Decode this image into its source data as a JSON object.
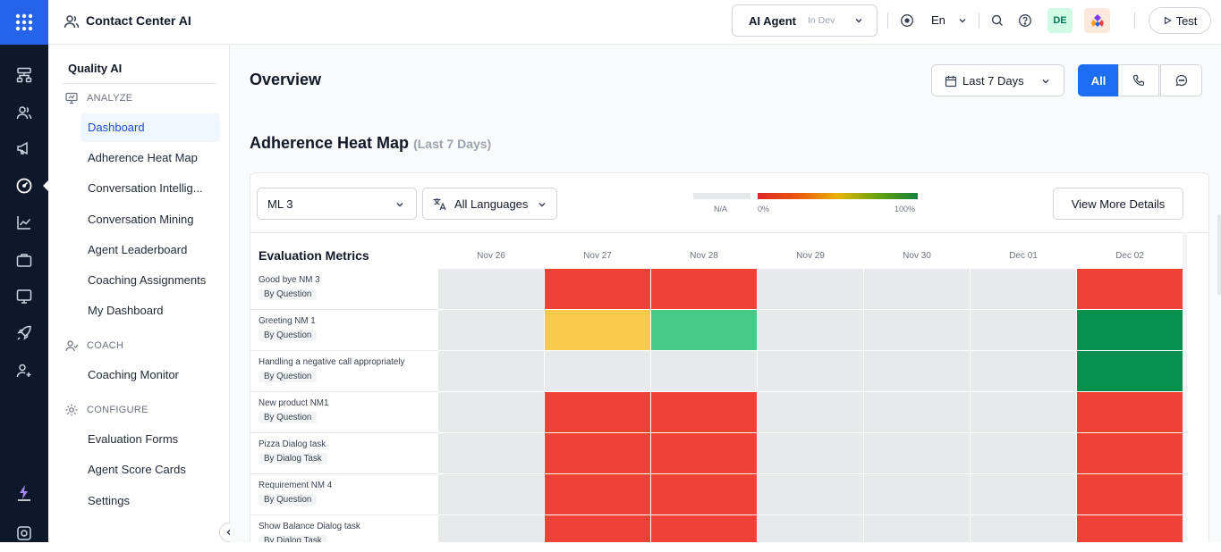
{
  "app": {
    "title": "Contact Center AI"
  },
  "topbar": {
    "agent_label": "AI Agent",
    "agent_env": "In Dev",
    "language": "En",
    "avatar_initials": "DE",
    "test_label": "Test"
  },
  "sidebar": {
    "header": "Quality AI",
    "sections": {
      "analyze": "ANALYZE",
      "coach": "COACH",
      "configure": "CONFIGURE"
    },
    "analyze_items": [
      "Dashboard",
      "Adherence Heat Map",
      "Conversation Intellig...",
      "Conversation Mining",
      "Agent Leaderboard",
      "Coaching Assignments",
      "My Dashboard"
    ],
    "coach_items": [
      "Coaching Monitor"
    ],
    "configure_items": [
      "Evaluation Forms",
      "Agent Score Cards",
      "Settings"
    ],
    "active_item": "Dashboard"
  },
  "overview": {
    "title": "Overview",
    "date_range": "Last 7 Days",
    "channel_all": "All"
  },
  "heatmap": {
    "title": "Adherence Heat Map",
    "subtitle": "(Last 7 Days)",
    "model_select": "ML 3",
    "language_select": "All Languages",
    "legend_na": "N/A",
    "legend_min": "0%",
    "legend_max": "100%",
    "view_more": "View More Details",
    "metrics_header": "Evaluation Metrics",
    "dates": [
      "Nov 26",
      "Nov 27",
      "Nov 28",
      "Nov 29",
      "Nov 30",
      "Dec 01",
      "Dec 02"
    ],
    "rows": [
      {
        "name": "Good bye NM 3",
        "type": "By Question",
        "cells": [
          "na",
          "#ef4136",
          "#ef4136",
          "na",
          "na",
          "na",
          "#ef4136"
        ]
      },
      {
        "name": "Greeting NM 1",
        "type": "By Question",
        "cells": [
          "na",
          "#fbc94b",
          "#47ca85",
          "na",
          "na",
          "na",
          "#07904d"
        ]
      },
      {
        "name": "Handling a negative call appropriately",
        "type": "By Question",
        "cells": [
          "na",
          "na",
          "na",
          "na",
          "na",
          "na",
          "#07904d"
        ]
      },
      {
        "name": "New product NM1",
        "type": "By Question",
        "cells": [
          "na",
          "#ef4136",
          "#ef4136",
          "na",
          "na",
          "na",
          "#ef4136"
        ]
      },
      {
        "name": "Pizza Dialog task",
        "type": "By Dialog Task",
        "cells": [
          "na",
          "#ef4136",
          "#ef4136",
          "na",
          "na",
          "na",
          "#ef4136"
        ]
      },
      {
        "name": "Requirement NM 4",
        "type": "By Question",
        "cells": [
          "na",
          "#ef4136",
          "#ef4136",
          "na",
          "na",
          "na",
          "#ef4136"
        ]
      },
      {
        "name": "Show Balance Dialog task",
        "type": "By Dialog Task",
        "cells": [
          "na",
          "#ef4136",
          "#ef4136",
          "na",
          "na",
          "na",
          "#ef4136"
        ]
      }
    ],
    "na_color": "#e8e9ec"
  }
}
